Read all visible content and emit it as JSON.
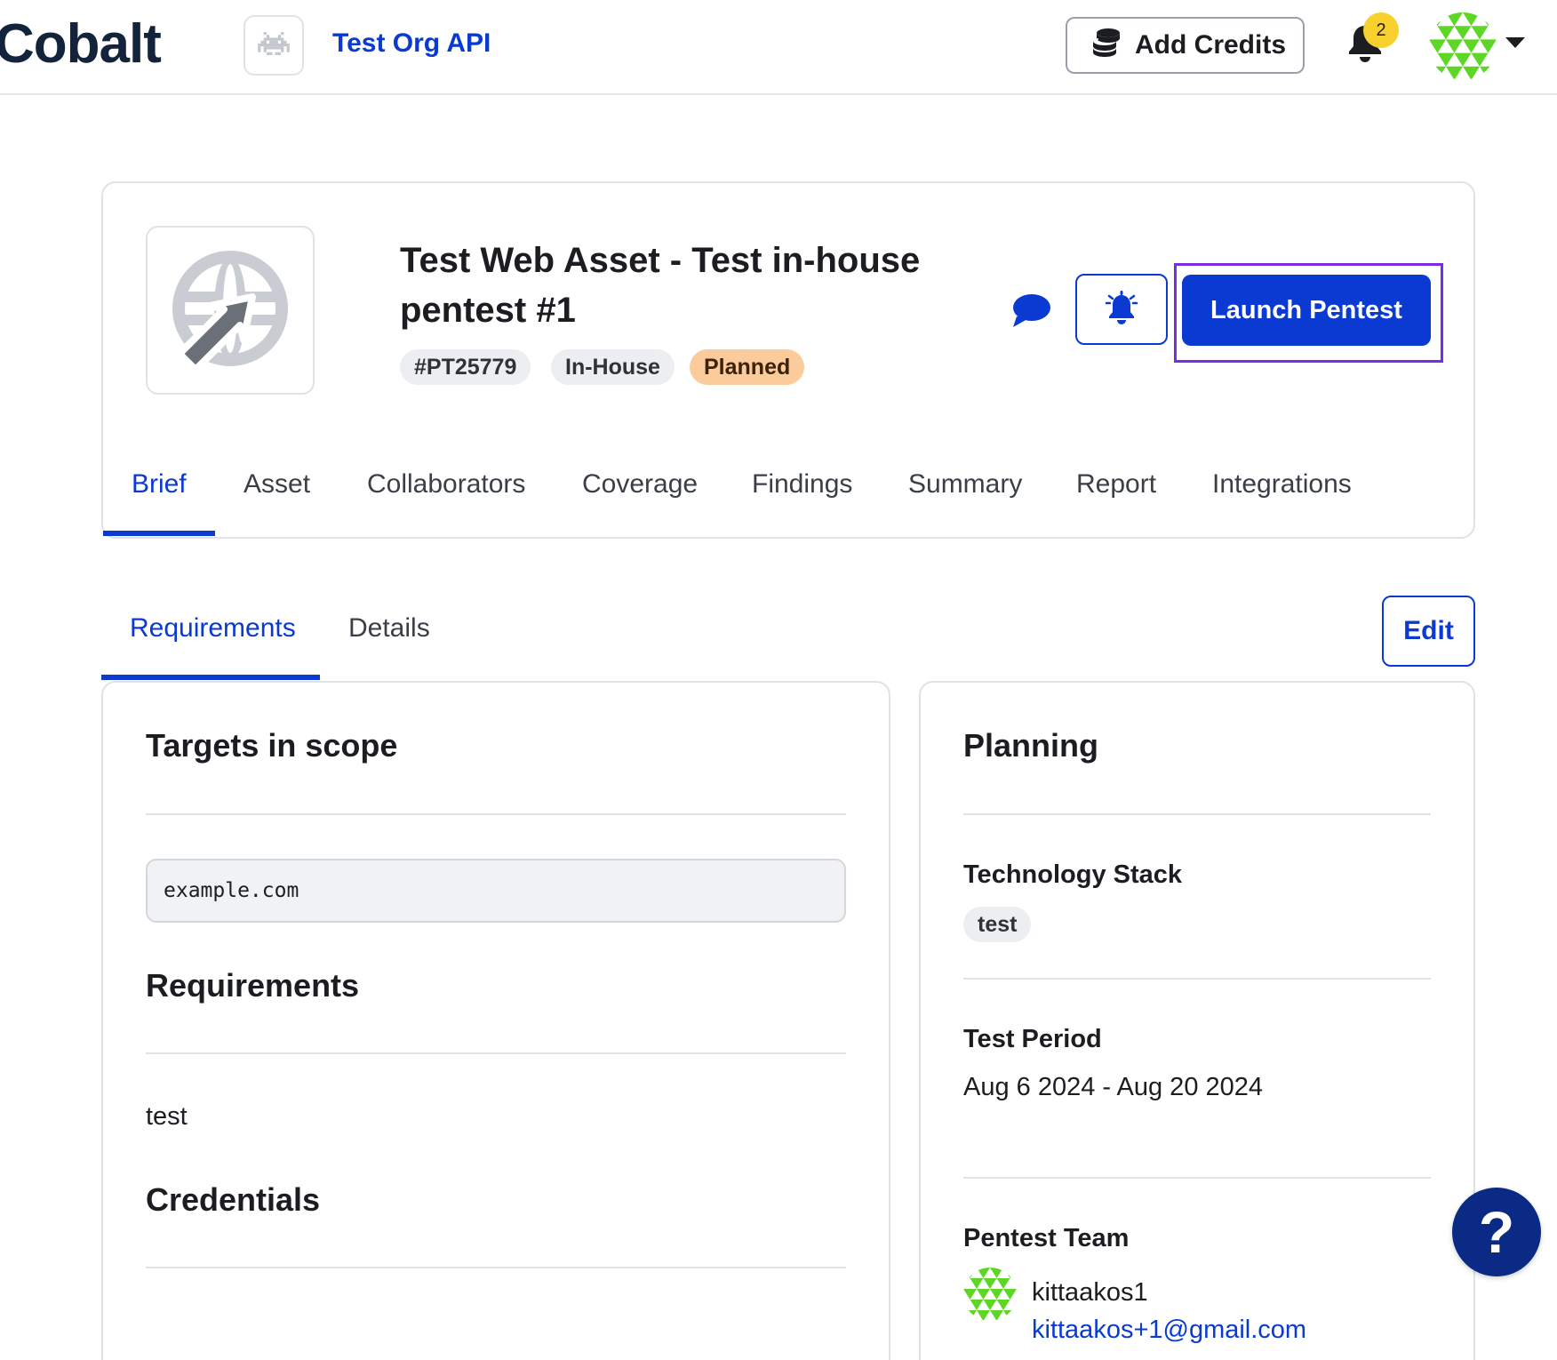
{
  "topbar": {
    "logo_text": "Cobalt",
    "org_name": "Test Org API",
    "add_credits_label": "Add Credits",
    "notification_count": "2",
    "icons": {
      "org": "space-invader-icon",
      "credits": "coins-stack-icon",
      "bell": "bell-icon",
      "avatar": "geometric-avatar",
      "menu": "chevron-down-icon"
    }
  },
  "pentest": {
    "title": "Test Web Asset - Test in-house pentest #1",
    "id": "#PT25779",
    "type": "In-House",
    "status": "Planned",
    "launch_label": "Launch Pentest",
    "icons": {
      "asset": "globe-cursor-icon",
      "chat": "chat-bubble-icon",
      "notify": "bell-ringing-icon"
    }
  },
  "tabs": [
    "Brief",
    "Asset",
    "Collaborators",
    "Coverage",
    "Findings",
    "Summary",
    "Report",
    "Integrations"
  ],
  "subtabs": [
    "Requirements",
    "Details"
  ],
  "edit_label": "Edit",
  "brief": {
    "targets_heading": "Targets in scope",
    "target_value": "example.com",
    "requirements_heading": "Requirements",
    "requirements_value": "test",
    "credentials_heading": "Credentials"
  },
  "planning": {
    "heading": "Planning",
    "tech_stack_label": "Technology Stack",
    "tech_stack_value": "test",
    "period_label": "Test Period",
    "period_value": "Aug 6 2024 - Aug 20 2024",
    "team_label": "Pentest Team",
    "member_name": "kittaakos1",
    "member_email": "kittaakos+1@gmail.com"
  },
  "help_label": "?",
  "colors": {
    "brand_blue": "#0a3ad1",
    "planned_pill": "#fbcb9b",
    "highlight": "#7b2bdf",
    "help": "#0b2a85",
    "avatar_green": "#5ed625"
  }
}
